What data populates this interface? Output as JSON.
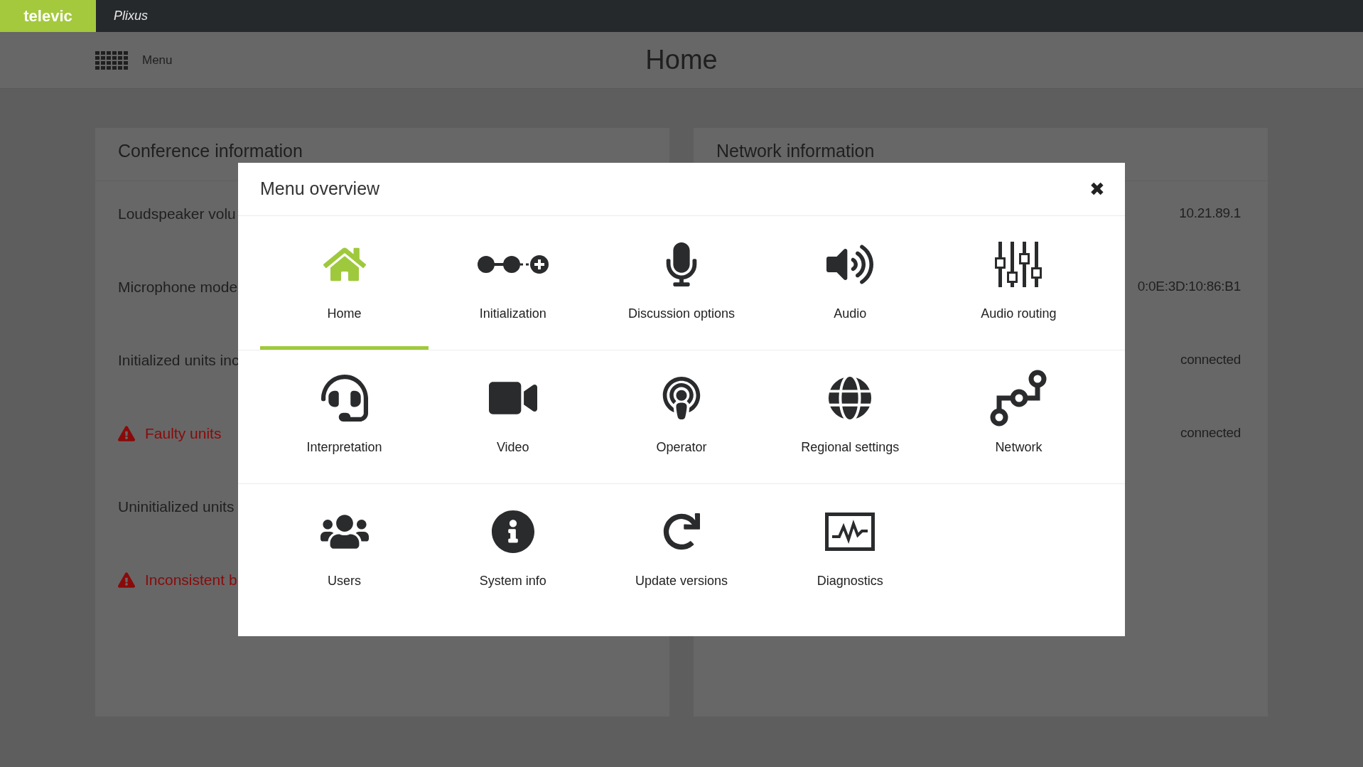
{
  "top_bar": {
    "logo": "televic",
    "product": "Plixus"
  },
  "header": {
    "menu_label": "Menu",
    "title": "Home"
  },
  "conference_panel": {
    "title": "Conference information",
    "rows": [
      {
        "label": "Loudspeaker volu",
        "warning": false
      },
      {
        "label": "Microphone mode",
        "warning": false
      },
      {
        "label": "Initialized units inc",
        "warning": false
      },
      {
        "label": "Faulty units",
        "warning": true
      },
      {
        "label": "Uninitialized units",
        "warning": false
      },
      {
        "label": "Inconsistent b",
        "warning": true
      }
    ]
  },
  "network_panel": {
    "title": "Network information",
    "values": [
      "10.21.89.1",
      "0:0E:3D:10:86:B1",
      "connected",
      "connected"
    ]
  },
  "menu_overview": {
    "title": "Menu overview",
    "close": "✖",
    "items": [
      {
        "label": "Home",
        "selected": true
      },
      {
        "label": "Initialization",
        "selected": false
      },
      {
        "label": "Discussion options",
        "selected": false
      },
      {
        "label": "Audio",
        "selected": false
      },
      {
        "label": "Audio routing",
        "selected": false
      },
      {
        "label": "Interpretation",
        "selected": false
      },
      {
        "label": "Video",
        "selected": false
      },
      {
        "label": "Operator",
        "selected": false
      },
      {
        "label": "Regional settings",
        "selected": false
      },
      {
        "label": "Network",
        "selected": false
      },
      {
        "label": "Users",
        "selected": false
      },
      {
        "label": "System info",
        "selected": false
      },
      {
        "label": "Update versions",
        "selected": false
      },
      {
        "label": "Diagnostics",
        "selected": false
      }
    ]
  }
}
